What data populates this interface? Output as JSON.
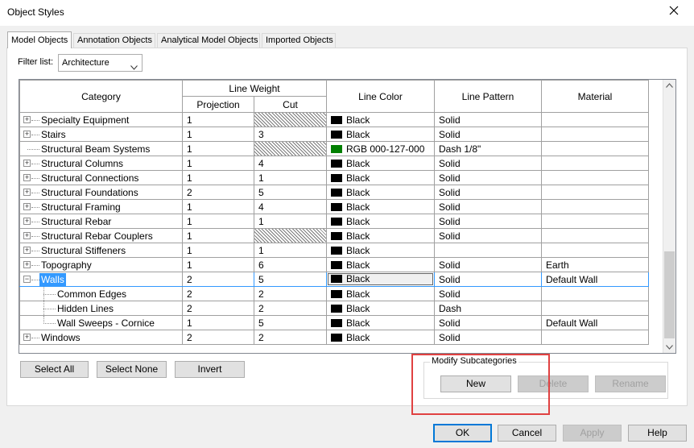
{
  "window": {
    "title": "Object Styles"
  },
  "tabs": [
    {
      "label": "Model Objects",
      "active": true
    },
    {
      "label": "Annotation Objects",
      "active": false
    },
    {
      "label": "Analytical Model Objects",
      "active": false
    },
    {
      "label": "Imported Objects",
      "active": false
    }
  ],
  "filter": {
    "label": "Filter list:",
    "value": "Architecture"
  },
  "table": {
    "headers": {
      "category": "Category",
      "line_weight": "Line Weight",
      "projection": "Projection",
      "cut": "Cut",
      "line_color": "Line Color",
      "line_pattern": "Line Pattern",
      "material": "Material"
    },
    "rows": [
      {
        "category": "Specialty Equipment",
        "projection": "1",
        "cut": "",
        "color": "Black",
        "color_hex": "#000000",
        "pattern": "Solid",
        "material": ""
      },
      {
        "category": "Stairs",
        "projection": "1",
        "cut": "3",
        "color": "Black",
        "color_hex": "#000000",
        "pattern": "Solid",
        "material": ""
      },
      {
        "category": "Structural Beam Systems",
        "projection": "1",
        "cut": "",
        "color": "RGB 000-127-000",
        "color_hex": "#007f00",
        "pattern": "Dash 1/8\"",
        "material": ""
      },
      {
        "category": "Structural Columns",
        "projection": "1",
        "cut": "4",
        "color": "Black",
        "color_hex": "#000000",
        "pattern": "Solid",
        "material": ""
      },
      {
        "category": "Structural Connections",
        "projection": "1",
        "cut": "1",
        "color": "Black",
        "color_hex": "#000000",
        "pattern": "Solid",
        "material": ""
      },
      {
        "category": "Structural Foundations",
        "projection": "2",
        "cut": "5",
        "color": "Black",
        "color_hex": "#000000",
        "pattern": "Solid",
        "material": ""
      },
      {
        "category": "Structural Framing",
        "projection": "1",
        "cut": "4",
        "color": "Black",
        "color_hex": "#000000",
        "pattern": "Solid",
        "material": ""
      },
      {
        "category": "Structural Rebar",
        "projection": "1",
        "cut": "1",
        "color": "Black",
        "color_hex": "#000000",
        "pattern": "Solid",
        "material": ""
      },
      {
        "category": "Structural Rebar Couplers",
        "projection": "1",
        "cut": "",
        "color": "Black",
        "color_hex": "#000000",
        "pattern": "Solid",
        "material": ""
      },
      {
        "category": "Structural Stiffeners",
        "projection": "1",
        "cut": "1",
        "color": "Black",
        "color_hex": "#000000",
        "pattern": "",
        "material": ""
      },
      {
        "category": "Topography",
        "projection": "1",
        "cut": "6",
        "color": "Black",
        "color_hex": "#000000",
        "pattern": "Solid",
        "material": "Earth"
      },
      {
        "category": "Walls",
        "projection": "2",
        "cut": "5",
        "color": "Black",
        "color_hex": "#000000",
        "pattern": "Solid",
        "material": "Default Wall"
      },
      {
        "category": "Common Edges",
        "projection": "2",
        "cut": "2",
        "color": "Black",
        "color_hex": "#000000",
        "pattern": "Solid",
        "material": ""
      },
      {
        "category": "Hidden Lines",
        "projection": "2",
        "cut": "2",
        "color": "Black",
        "color_hex": "#000000",
        "pattern": "Dash",
        "material": ""
      },
      {
        "category": "Wall Sweeps - Cornice",
        "projection": "1",
        "cut": "5",
        "color": "Black",
        "color_hex": "#000000",
        "pattern": "Solid",
        "material": "Default Wall"
      },
      {
        "category": "Windows",
        "projection": "2",
        "cut": "2",
        "color": "Black",
        "color_hex": "#000000",
        "pattern": "Solid",
        "material": ""
      }
    ]
  },
  "selection_buttons": {
    "select_all": "Select All",
    "select_none": "Select None",
    "invert": "Invert"
  },
  "modify_subcategories": {
    "label": "Modify Subcategories",
    "new": "New",
    "delete": "Delete",
    "rename": "Rename"
  },
  "dialog_buttons": {
    "ok": "OK",
    "cancel": "Cancel",
    "apply": "Apply",
    "help": "Help"
  },
  "colors": {
    "selection": "#3399ff",
    "highlight_outline": "#e04141",
    "default_button_border": "#0078d7"
  }
}
